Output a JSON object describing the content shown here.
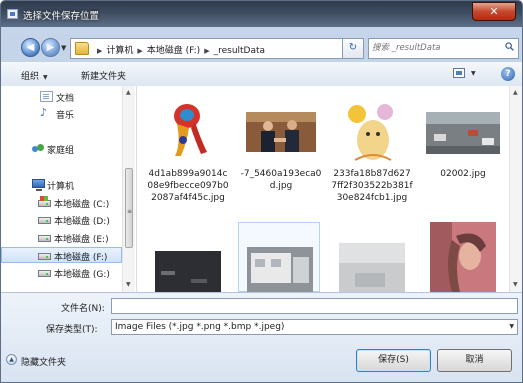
{
  "window": {
    "title": "选择文件保存位置",
    "close_label": "✕"
  },
  "address": {
    "crumbs": [
      "计算机",
      "本地磁盘 (F:)",
      "_resultData"
    ],
    "search_placeholder": "搜索 _resultData",
    "back_glyph": "◀",
    "forward_glyph": "▶",
    "refresh_glyph": "↻"
  },
  "toolbar": {
    "organize_label": "组织",
    "new_folder_label": "新建文件夹",
    "help_glyph": "?"
  },
  "nav": {
    "items": [
      {
        "label": "文档",
        "icon": "document-icon"
      },
      {
        "label": "音乐",
        "icon": "music-icon"
      },
      {
        "label": "家庭组",
        "icon": "homegroup-icon"
      },
      {
        "label": "计算机",
        "icon": "computer-icon"
      },
      {
        "label": "本地磁盘 (C:)",
        "icon": "drive-icon"
      },
      {
        "label": "本地磁盘 (D:)",
        "icon": "drive-icon"
      },
      {
        "label": "本地磁盘 (E:)",
        "icon": "drive-icon"
      },
      {
        "label": "本地磁盘 (F:)",
        "icon": "drive-icon",
        "selected": true
      },
      {
        "label": "本地磁盘 (G:)",
        "icon": "drive-icon"
      }
    ]
  },
  "files": [
    {
      "name": "4d1ab899a9014c08e9fbecce097b02087af4f45c.jpg"
    },
    {
      "name": "-7_5460a193eca0d.jpg"
    },
    {
      "name": "233fa18b87d6277ff2f303522b381f30e824fcb1.jpg"
    },
    {
      "name": "02002.jpg"
    },
    {
      "name": ""
    },
    {
      "name": ""
    },
    {
      "name": ""
    },
    {
      "name": ""
    }
  ],
  "save": {
    "filename_label": "文件名(N):",
    "filename_value": "",
    "filetype_label": "保存类型(T):",
    "filetype_value": "Image Files (*.jpg *.png *.bmp *.jpeg)",
    "hide_folders_label": "隐藏文件夹",
    "save_button": "保存(S)",
    "cancel_button": "取消"
  }
}
